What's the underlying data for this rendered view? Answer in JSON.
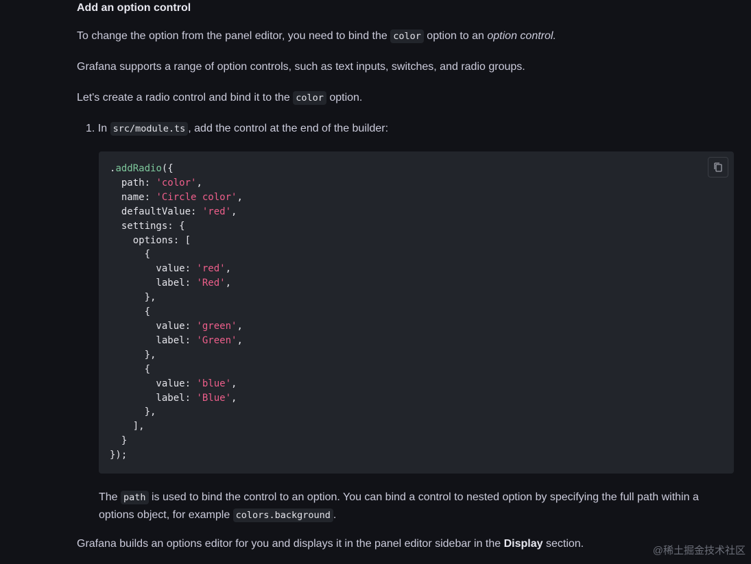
{
  "section": {
    "heading": "Add an option control"
  },
  "paragraphs": {
    "p1_before": "To change the option from the panel editor, you need to bind the ",
    "p1_code": "color",
    "p1_middle": " option to an ",
    "p1_emphasis": "option control.",
    "p2": "Grafana supports a range of option controls, such as text inputs, switches, and radio groups.",
    "p3_before": "Let's create a radio control and bind it to the ",
    "p3_code": "color",
    "p3_after": " option."
  },
  "step": {
    "number": "1.",
    "before": " In ",
    "code": "src/module.ts",
    "after": ", add the control at the end of the builder:"
  },
  "code_block": {
    "lines": [
      [
        {
          "t": ".",
          "c": ""
        },
        {
          "t": "addRadio",
          "c": "fn"
        },
        {
          "t": "({",
          "c": ""
        }
      ],
      [
        {
          "t": "  path: ",
          "c": ""
        },
        {
          "t": "'color'",
          "c": "str"
        },
        {
          "t": ",",
          "c": ""
        }
      ],
      [
        {
          "t": "  name: ",
          "c": ""
        },
        {
          "t": "'Circle color'",
          "c": "str"
        },
        {
          "t": ",",
          "c": ""
        }
      ],
      [
        {
          "t": "  defaultValue: ",
          "c": ""
        },
        {
          "t": "'red'",
          "c": "str"
        },
        {
          "t": ",",
          "c": ""
        }
      ],
      [
        {
          "t": "  settings: {",
          "c": ""
        }
      ],
      [
        {
          "t": "    options: [",
          "c": ""
        }
      ],
      [
        {
          "t": "      {",
          "c": ""
        }
      ],
      [
        {
          "t": "        value: ",
          "c": ""
        },
        {
          "t": "'red'",
          "c": "str"
        },
        {
          "t": ",",
          "c": ""
        }
      ],
      [
        {
          "t": "        label: ",
          "c": ""
        },
        {
          "t": "'Red'",
          "c": "str"
        },
        {
          "t": ",",
          "c": ""
        }
      ],
      [
        {
          "t": "      },",
          "c": ""
        }
      ],
      [
        {
          "t": "      {",
          "c": ""
        }
      ],
      [
        {
          "t": "        value: ",
          "c": ""
        },
        {
          "t": "'green'",
          "c": "str"
        },
        {
          "t": ",",
          "c": ""
        }
      ],
      [
        {
          "t": "        label: ",
          "c": ""
        },
        {
          "t": "'Green'",
          "c": "str"
        },
        {
          "t": ",",
          "c": ""
        }
      ],
      [
        {
          "t": "      },",
          "c": ""
        }
      ],
      [
        {
          "t": "      {",
          "c": ""
        }
      ],
      [
        {
          "t": "        value: ",
          "c": ""
        },
        {
          "t": "'blue'",
          "c": "str"
        },
        {
          "t": ",",
          "c": ""
        }
      ],
      [
        {
          "t": "        label: ",
          "c": ""
        },
        {
          "t": "'Blue'",
          "c": "str"
        },
        {
          "t": ",",
          "c": ""
        }
      ],
      [
        {
          "t": "      },",
          "c": ""
        }
      ],
      [
        {
          "t": "    ],",
          "c": ""
        }
      ],
      [
        {
          "t": "  }",
          "c": ""
        }
      ],
      [
        {
          "t": "});",
          "c": ""
        }
      ]
    ],
    "copy_icon": "copy-icon"
  },
  "note": {
    "before": "The ",
    "code1": "path",
    "middle": " is used to bind the control to an option. You can bind a control to nested option by specifying the full path within a options object, for example ",
    "code2": "colors.background",
    "after": "."
  },
  "final": {
    "before": "Grafana builds an options editor for you and displays it in the panel editor sidebar in the ",
    "strong": "Display",
    "after": " section."
  },
  "watermark": "@稀土掘金技术社区",
  "colors": {
    "background": "#111217",
    "code_background": "#22252b",
    "function": "#7ec89c",
    "string": "#ee5f8b",
    "text": "#ccccdc"
  }
}
